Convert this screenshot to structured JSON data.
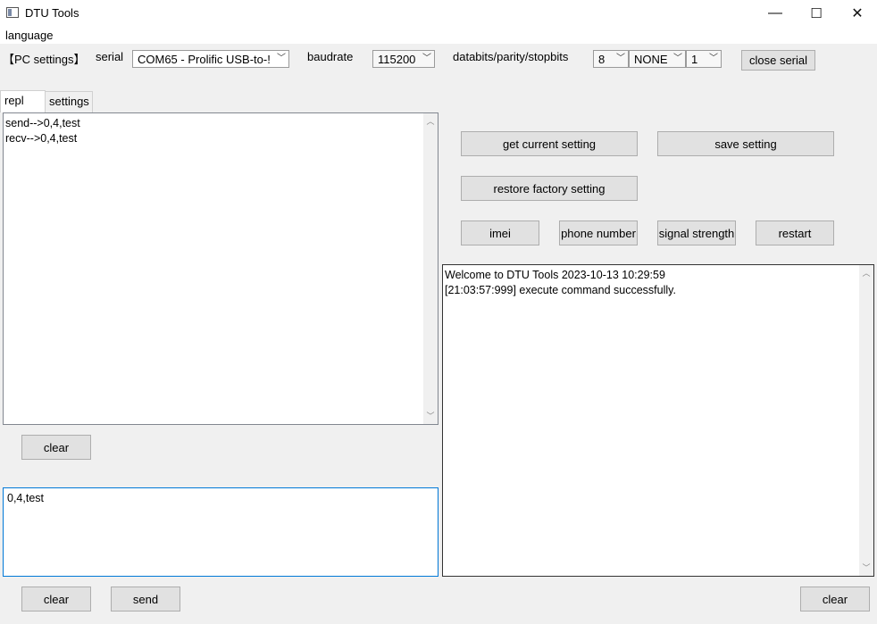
{
  "window": {
    "title": "DTU Tools",
    "minimize_glyph": "—",
    "maximize_glyph": "☐",
    "close_glyph": "✕"
  },
  "menu": {
    "language": "language"
  },
  "pc_settings": {
    "section_label": "【PC settings】",
    "serial_label": "serial",
    "serial_value": "COM65 - Prolific USB-to-!",
    "baudrate_label": "baudrate",
    "baudrate_value": "115200",
    "frame_label": "databits/parity/stopbits",
    "databits_value": "8",
    "parity_value": "NONE",
    "stopbits_value": "1",
    "close_serial_button": "close serial"
  },
  "tabs": [
    {
      "label": "repl"
    },
    {
      "label": "settings"
    }
  ],
  "repl": {
    "log_lines": [
      "send-->0,4,test",
      "recv-->0,4,test"
    ],
    "clear_log_button": "clear",
    "input_value": "0,4,test",
    "clear_input_button": "clear",
    "send_button": "send"
  },
  "dtu_actions": {
    "get_current_setting": "get current setting",
    "save_setting": "save setting",
    "restore_factory_setting": "restore factory setting",
    "imei": "imei",
    "phone_number": "phone number",
    "signal_strength": "signal strength",
    "restart": "restart"
  },
  "output": {
    "lines": [
      "Welcome to DTU Tools 2023-10-13 10:29:59",
      "[21:03:57:999] execute command successfully."
    ],
    "clear_button": "clear"
  },
  "icons": {
    "dropdown_arrow": "chevron-down-icon",
    "scroll_up": "scroll-up-arrow-icon",
    "scroll_down": "scroll-down-arrow-icon"
  }
}
